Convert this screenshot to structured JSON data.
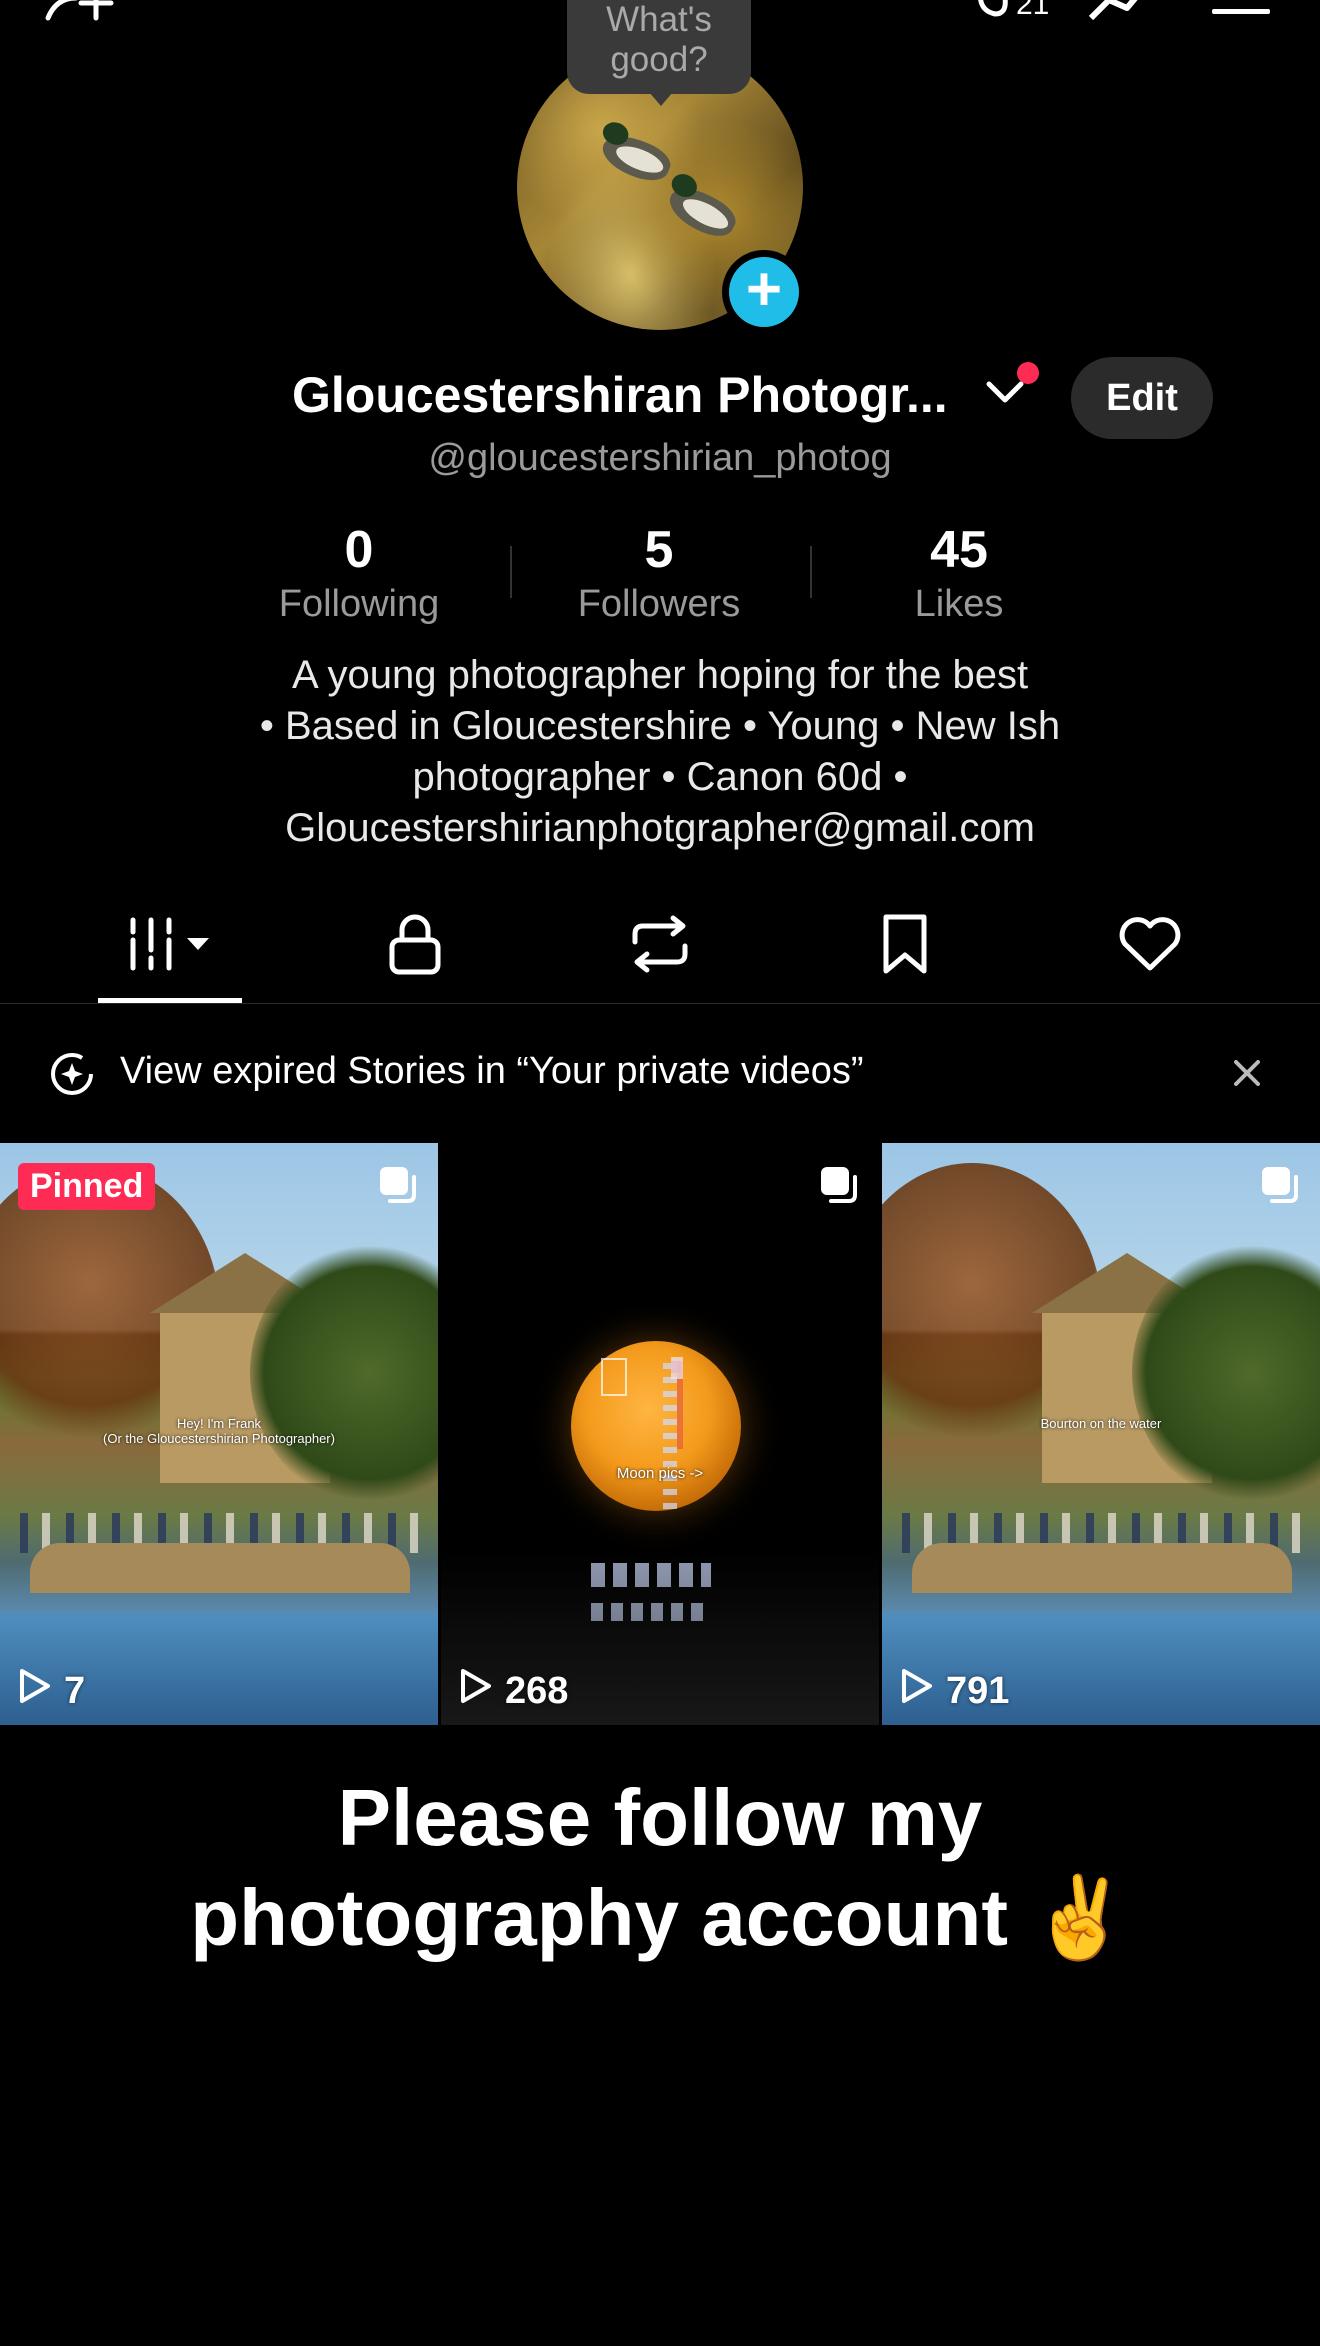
{
  "top_bar": {
    "notification_count": "21"
  },
  "avatar": {
    "speech_bubble": [
      "What's",
      "good?"
    ]
  },
  "profile": {
    "display_name": "Gloucestershiran Photogr...",
    "handle": "@gloucestershirian_photog",
    "edit_label": "Edit"
  },
  "stats": [
    {
      "value": "0",
      "label": "Following"
    },
    {
      "value": "5",
      "label": "Followers"
    },
    {
      "value": "45",
      "label": "Likes"
    }
  ],
  "bio": [
    "A young photographer hoping for the best",
    "• Based in Gloucestershire • Young • New Ish",
    "photographer • Canon 60d •",
    "Gloucestershirianphotgrapher@gmail.com"
  ],
  "tabs": [
    {
      "icon": "videos-grid-icon",
      "active": true
    },
    {
      "icon": "lock-icon"
    },
    {
      "icon": "repost-icon"
    },
    {
      "icon": "bookmark-icon"
    },
    {
      "icon": "heart-icon"
    }
  ],
  "banner": {
    "text": "View expired Stories in “Your private videos”"
  },
  "videos": [
    {
      "badge": "Pinned",
      "overlay": [
        "Hey! I'm Frank",
        "(Or the Gloucestershirian Photographer)"
      ],
      "views": "7"
    },
    {
      "overlay": [
        "Moon pics ->"
      ],
      "views": "268"
    },
    {
      "overlay": [
        "Bourton on the water"
      ],
      "views": "791"
    }
  ],
  "caption": [
    "Please follow my",
    "photography account ✌️"
  ],
  "colors": {
    "accent_red": "#fe2c55",
    "accent_blue": "#20bde8",
    "background": "#000000"
  }
}
